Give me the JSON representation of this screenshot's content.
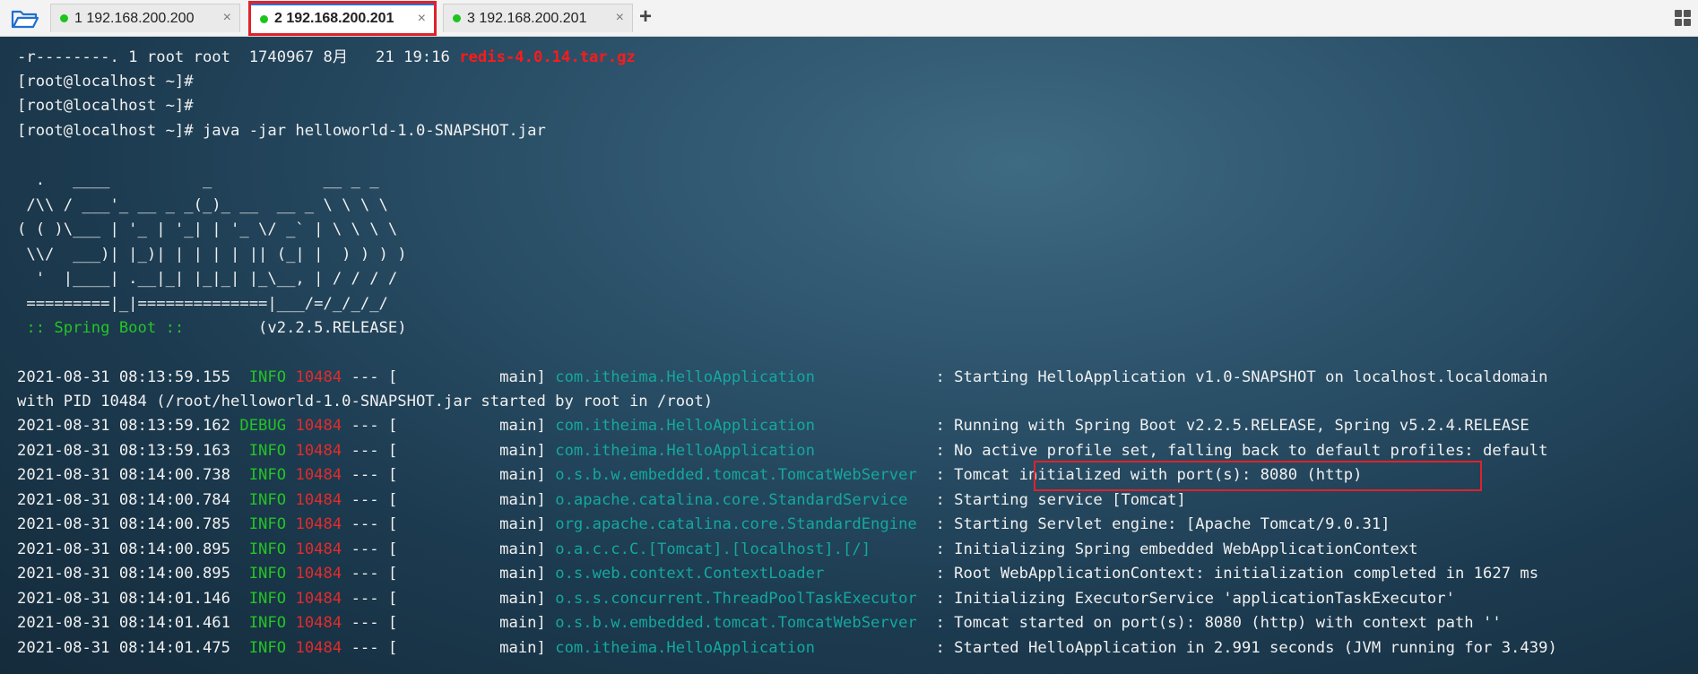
{
  "tabs": [
    {
      "label": "1 192.168.200.200",
      "status_color": "#1ec41e"
    },
    {
      "label": "2 192.168.200.201",
      "status_color": "#1ec41e"
    },
    {
      "label": "3 192.168.200.201",
      "status_color": "#1ec41e"
    }
  ],
  "tab_close_symbol": "×",
  "add_tab_symbol": "+",
  "icons": {
    "folder": "folder-icon",
    "layout": "layout-grid-icon"
  },
  "terminal": {
    "ls_line": {
      "prefix": "-r--------. 1 root root  1740967 8月   21 19:16 ",
      "file": "redis-4.0.14.tar.gz"
    },
    "prompt1": "[root@localhost ~]#",
    "prompt2": "[root@localhost ~]#",
    "command_line": "[root@localhost ~]# java -jar helloworld-1.0-SNAPSHOT.jar",
    "banner": [
      "  .   ____          _            __ _ _",
      " /\\\\ / ___'_ __ _ _(_)_ __  __ _ \\ \\ \\ \\",
      "( ( )\\___ | '_ | '_| | '_ \\/ _` | \\ \\ \\ \\",
      " \\\\/  ___)| |_)| | | | | || (_| |  ) ) ) )",
      "  '  |____| .__|_| |_|_| |_\\__, | / / / /",
      " =========|_|==============|___/=/_/_/_/"
    ],
    "spring_label": " :: Spring Boot :: ",
    "spring_version": "       (v2.2.5.RELEASE)",
    "pid": "10484",
    "log_lines": [
      {
        "timestamp": "2021-08-31 08:13:59.155",
        "level": "INFO",
        "thread": "main",
        "logger": "com.itheima.HelloApplication",
        "message": "Starting HelloApplication v1.0-SNAPSHOT on localhost.localdomain"
      },
      {
        "timestamp": "2021-08-31 08:13:59.162",
        "level": "DEBUG",
        "thread": "main",
        "logger": "com.itheima.HelloApplication",
        "message": "Running with Spring Boot v2.2.5.RELEASE, Spring v5.2.4.RELEASE"
      },
      {
        "timestamp": "2021-08-31 08:13:59.163",
        "level": "INFO",
        "thread": "main",
        "logger": "com.itheima.HelloApplication",
        "message": "No active profile set, falling back to default profiles: default"
      },
      {
        "timestamp": "2021-08-31 08:14:00.738",
        "level": "INFO",
        "thread": "main",
        "logger": "o.s.b.w.embedded.tomcat.TomcatWebServer",
        "message": "Tomcat initialized with port(s): 8080 (http)"
      },
      {
        "timestamp": "2021-08-31 08:14:00.784",
        "level": "INFO",
        "thread": "main",
        "logger": "o.apache.catalina.core.StandardService",
        "message": "Starting service [Tomcat]"
      },
      {
        "timestamp": "2021-08-31 08:14:00.785",
        "level": "INFO",
        "thread": "main",
        "logger": "org.apache.catalina.core.StandardEngine",
        "message": "Starting Servlet engine: [Apache Tomcat/9.0.31]"
      },
      {
        "timestamp": "2021-08-31 08:14:00.895",
        "level": "INFO",
        "thread": "main",
        "logger": "o.a.c.c.C.[Tomcat].[localhost].[/]",
        "message": "Initializing Spring embedded WebApplicationContext"
      },
      {
        "timestamp": "2021-08-31 08:14:00.895",
        "level": "INFO",
        "thread": "main",
        "logger": "o.s.web.context.ContextLoader",
        "message": "Root WebApplicationContext: initialization completed in 1627 ms"
      },
      {
        "timestamp": "2021-08-31 08:14:01.146",
        "level": "INFO",
        "thread": "main",
        "logger": "o.s.s.concurrent.ThreadPoolTaskExecutor",
        "message": "Initializing ExecutorService 'applicationTaskExecutor'"
      },
      {
        "timestamp": "2021-08-31 08:14:01.461",
        "level": "INFO",
        "thread": "main",
        "logger": "o.s.b.w.embedded.tomcat.TomcatWebServer",
        "message": "Tomcat started on port(s): 8080 (http) with context path ''"
      },
      {
        "timestamp": "2021-08-31 08:14:01.475",
        "level": "INFO",
        "thread": "main",
        "logger": "com.itheima.HelloApplication",
        "message": "Started HelloApplication in 2.991 seconds (JVM running for 3.439)"
      }
    ],
    "wrap_line": "with PID 10484 (/root/helloworld-1.0-SNAPSHOT.jar started by root in /root)"
  },
  "colors": {
    "level_info": "#24c424",
    "level_debug": "#24c424",
    "pid": "#e32b2b",
    "logger": "#14a89e",
    "highlight": "#e0222a"
  }
}
